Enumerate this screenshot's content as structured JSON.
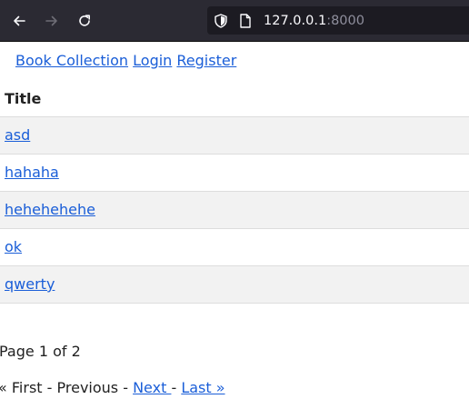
{
  "browser": {
    "url_host": "127.0.0.1",
    "url_port": ":8000"
  },
  "nav": {
    "brand": "Book Collection",
    "login": "Login",
    "register": "Register"
  },
  "table": {
    "header": "Title",
    "rows": [
      "asd",
      "hahaha",
      "hehehehehe",
      "ok",
      "qwerty"
    ]
  },
  "pagination": {
    "info": "Page 1 of 2",
    "first": "« First",
    "sep1": " - ",
    "previous": "Previous",
    "sep2": " - ",
    "next": "Next ",
    "sep3": "-",
    "last": "Last »"
  },
  "colors": {
    "link": "#1a5ed8",
    "row_stripe": "#f2f2f2",
    "toolbar": "#2b2a33"
  }
}
